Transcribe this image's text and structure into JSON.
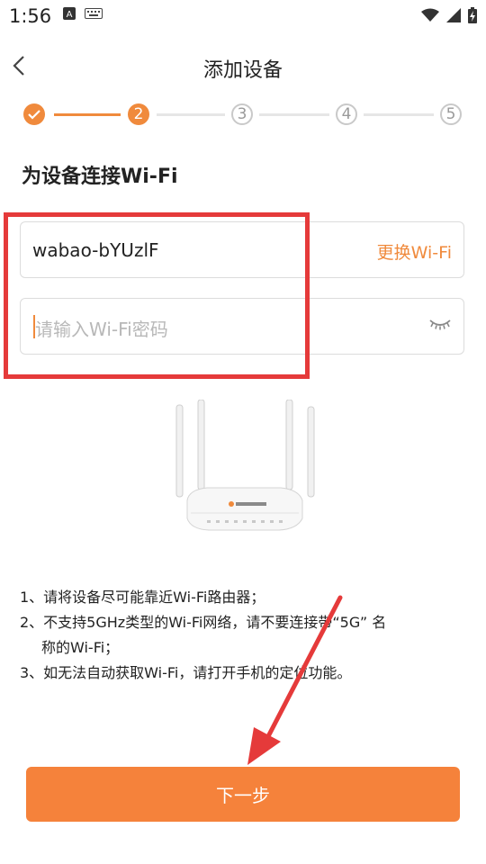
{
  "status_bar": {
    "time": "1:56",
    "icons": [
      "a-badge-icon",
      "keyboard-icon",
      "wifi-icon",
      "signal-icon",
      "battery-charging-icon"
    ]
  },
  "header": {
    "title": "添加设备",
    "back_icon": "chevron-left-icon"
  },
  "stepper": {
    "steps": [
      {
        "label": "",
        "state": "done"
      },
      {
        "label": "2",
        "state": "active"
      },
      {
        "label": "3",
        "state": "todo"
      },
      {
        "label": "4",
        "state": "todo"
      },
      {
        "label": "5",
        "state": "todo"
      }
    ],
    "accent": "#f08a3c"
  },
  "heading": "为设备连接Wi-Fi",
  "wifi": {
    "ssid": "wabao-bYUzlF",
    "change_label": "更换Wi-Fi",
    "password_placeholder": "请输入Wi-Fi密码",
    "password_value": ""
  },
  "tips": [
    "1、请将设备尽可能靠近Wi-Fi路由器；",
    "2、不支持5GHz类型的Wi-Fi网络，请不要连接带“5G” 名",
    "称的Wi-Fi；",
    "3、如无法自动获取Wi-Fi，请打开手机的定位功能。"
  ],
  "next_button": "下一步",
  "colors": {
    "accent": "#f08a3c",
    "button": "#f5823b",
    "annotation_red": "#e53a3a"
  }
}
